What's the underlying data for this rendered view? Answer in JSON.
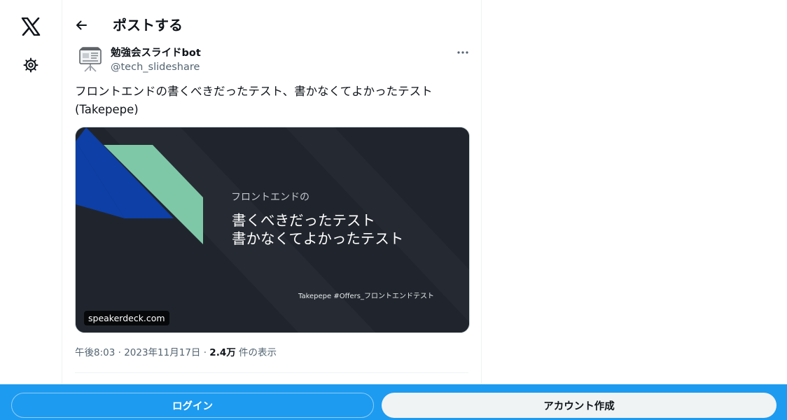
{
  "header": {
    "title": "ポストする"
  },
  "tweet": {
    "author_name": "勉強会スライドbot",
    "author_handle": "@tech_slideshare",
    "text": "フロントエンドの書くべきだったテスト、書かなくてよかったテスト (Takepepe)",
    "media": {
      "slide_subtitle": "フロントエンドの",
      "slide_title_line1": "書くべきだったテスト",
      "slide_title_line2": "書かなくてよかったテスト",
      "slide_footer": "Takepepe #Offers_フロントエンドテスト",
      "domain": "speakerdeck.com"
    },
    "meta": {
      "time": "午後8:03",
      "sep1": " · ",
      "date": "2023年11月17日",
      "sep2": " · ",
      "views": "2.4万",
      "views_suffix": " 件の表示"
    }
  },
  "bottom_bar": {
    "login_label": "ログイン",
    "signup_label": "アカウント作成"
  },
  "icons": {
    "logo": "x-logo-icon",
    "settings": "gear-icon",
    "back": "arrow-left-icon",
    "more": "more-horizontal-icon"
  },
  "colors": {
    "accent": "#1d9bf0",
    "slide_background": "#20252d",
    "slide_blue": "#0d3fa6",
    "slide_green": "#7ec8a8",
    "secondary_text": "#536471"
  }
}
